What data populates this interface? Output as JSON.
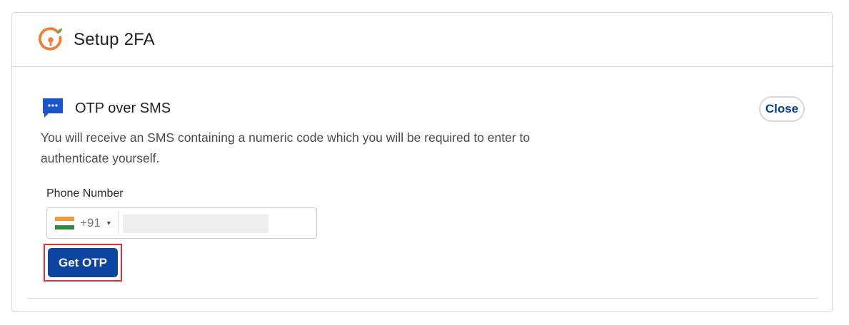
{
  "header": {
    "title": "Setup 2FA",
    "logo_icon": "keyhole-logo-icon"
  },
  "section": {
    "icon": "sms-chat-icon",
    "title": "OTP over SMS",
    "close_label": "Close",
    "description": "You will receive an SMS containing a numeric code which you will be required to enter to authenticate yourself."
  },
  "phone": {
    "label": "Phone Number",
    "country_flag": "india-flag-icon",
    "dial_code": "+91",
    "value": "",
    "placeholder": ""
  },
  "actions": {
    "get_otp_label": "Get OTP"
  },
  "colors": {
    "primary": "#0c44a0",
    "accent_orange": "#e8823b",
    "highlight_red": "#d8323f"
  }
}
